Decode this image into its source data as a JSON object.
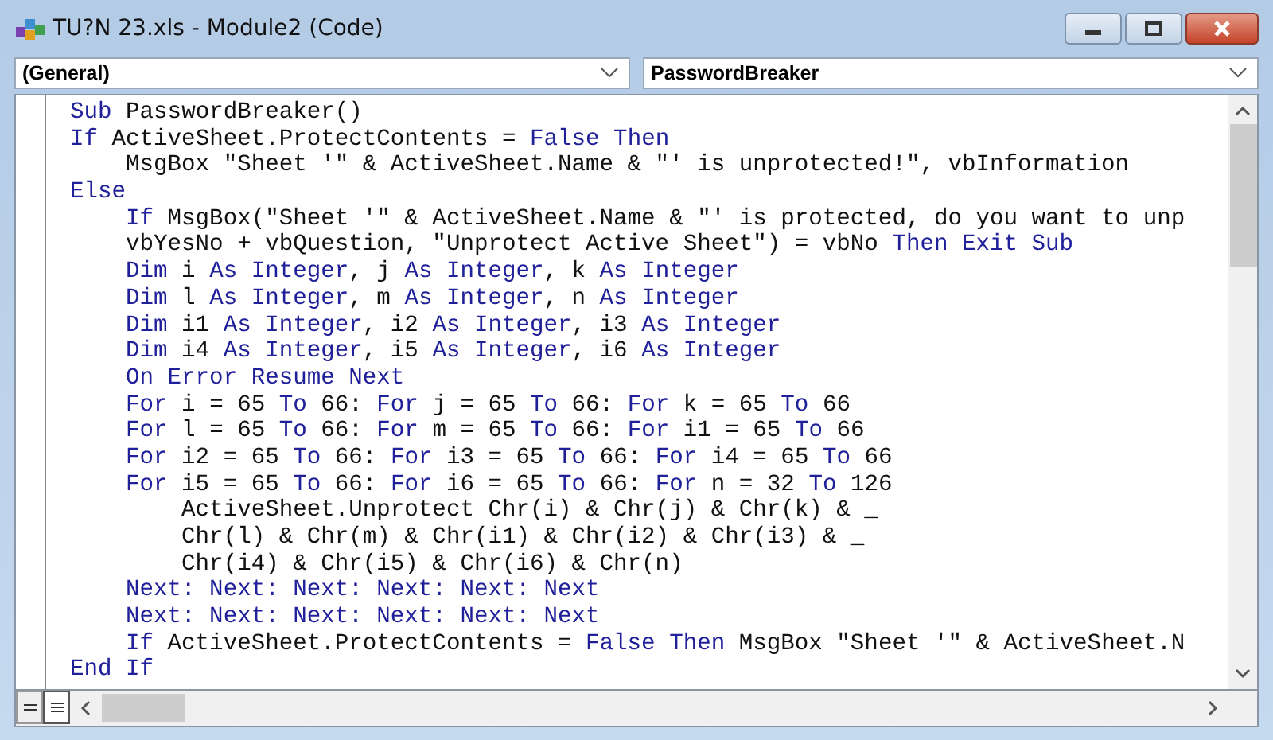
{
  "window": {
    "title": "TU?N 23.xls - Module2 (Code)"
  },
  "object_dropdown": {
    "value": "(General)"
  },
  "procedure_dropdown": {
    "value": "PasswordBreaker"
  },
  "code_lines": [
    {
      "tokens": [
        {
          "kind": "keyword",
          "text": "Sub"
        },
        {
          "kind": "text",
          "text": " PasswordBreaker()"
        }
      ]
    },
    {
      "tokens": [
        {
          "kind": "keyword",
          "text": "If"
        },
        {
          "kind": "text",
          "text": " ActiveSheet.ProtectContents = "
        },
        {
          "kind": "keyword",
          "text": "False Then"
        }
      ],
      "children": [
        {
          "tokens": [
            {
              "kind": "text",
              "text": "MsgBox \"Sheet '\" & ActiveSheet.Name & \"' is unprotected!\", vbInformation"
            }
          ]
        }
      ]
    },
    {
      "tokens": [
        {
          "kind": "keyword",
          "text": "Else"
        }
      ],
      "children": [
        {
          "tokens": [
            {
              "kind": "keyword",
              "text": "If"
            },
            {
              "kind": "text",
              "text": " MsgBox(\"Sheet '\" & ActiveSheet.Name & \"' is protected, do you want to unp"
            }
          ]
        },
        {
          "tokens": [
            {
              "kind": "text",
              "text": "vbYesNo + vbQuestion, \"Unprotect Active Sheet\") = vbNo "
            },
            {
              "kind": "keyword",
              "text": "Then Exit Sub"
            }
          ]
        },
        {
          "tokens": [
            {
              "kind": "keyword",
              "text": "Dim"
            },
            {
              "kind": "text",
              "text": " i "
            },
            {
              "kind": "keyword",
              "text": "As Integer"
            },
            {
              "kind": "text",
              "text": ", j "
            },
            {
              "kind": "keyword",
              "text": "As Integer"
            },
            {
              "kind": "text",
              "text": ", k "
            },
            {
              "kind": "keyword",
              "text": "As Integer"
            }
          ]
        },
        {
          "tokens": [
            {
              "kind": "keyword",
              "text": "Dim"
            },
            {
              "kind": "text",
              "text": " l "
            },
            {
              "kind": "keyword",
              "text": "As Integer"
            },
            {
              "kind": "text",
              "text": ", m "
            },
            {
              "kind": "keyword",
              "text": "As Integer"
            },
            {
              "kind": "text",
              "text": ", n "
            },
            {
              "kind": "keyword",
              "text": "As Integer"
            }
          ]
        },
        {
          "tokens": [
            {
              "kind": "keyword",
              "text": "Dim"
            },
            {
              "kind": "text",
              "text": " i1 "
            },
            {
              "kind": "keyword",
              "text": "As Integer"
            },
            {
              "kind": "text",
              "text": ", i2 "
            },
            {
              "kind": "keyword",
              "text": "As Integer"
            },
            {
              "kind": "text",
              "text": ", i3 "
            },
            {
              "kind": "keyword",
              "text": "As Integer"
            }
          ]
        },
        {
          "tokens": [
            {
              "kind": "keyword",
              "text": "Dim"
            },
            {
              "kind": "text",
              "text": " i4 "
            },
            {
              "kind": "keyword",
              "text": "As Integer"
            },
            {
              "kind": "text",
              "text": ", i5 "
            },
            {
              "kind": "keyword",
              "text": "As Integer"
            },
            {
              "kind": "text",
              "text": ", i6 "
            },
            {
              "kind": "keyword",
              "text": "As Integer"
            }
          ]
        },
        {
          "tokens": [
            {
              "kind": "keyword",
              "text": "On Error Resume Next"
            }
          ]
        },
        {
          "tokens": [
            {
              "kind": "keyword",
              "text": "For"
            },
            {
              "kind": "text",
              "text": " i = 65 "
            },
            {
              "kind": "keyword",
              "text": "To"
            },
            {
              "kind": "text",
              "text": " 66: "
            },
            {
              "kind": "keyword",
              "text": "For"
            },
            {
              "kind": "text",
              "text": " j = 65 "
            },
            {
              "kind": "keyword",
              "text": "To"
            },
            {
              "kind": "text",
              "text": " 66: "
            },
            {
              "kind": "keyword",
              "text": "For"
            },
            {
              "kind": "text",
              "text": " k = 65 "
            },
            {
              "kind": "keyword",
              "text": "To"
            },
            {
              "kind": "text",
              "text": " 66"
            }
          ]
        },
        {
          "tokens": [
            {
              "kind": "keyword",
              "text": "For"
            },
            {
              "kind": "text",
              "text": " l = 65 "
            },
            {
              "kind": "keyword",
              "text": "To"
            },
            {
              "kind": "text",
              "text": " 66: "
            },
            {
              "kind": "keyword",
              "text": "For"
            },
            {
              "kind": "text",
              "text": " m = 65 "
            },
            {
              "kind": "keyword",
              "text": "To"
            },
            {
              "kind": "text",
              "text": " 66: "
            },
            {
              "kind": "keyword",
              "text": "For"
            },
            {
              "kind": "text",
              "text": " i1 = 65 "
            },
            {
              "kind": "keyword",
              "text": "To"
            },
            {
              "kind": "text",
              "text": " 66"
            }
          ]
        },
        {
          "tokens": [
            {
              "kind": "keyword",
              "text": "For"
            },
            {
              "kind": "text",
              "text": " i2 = 65 "
            },
            {
              "kind": "keyword",
              "text": "To"
            },
            {
              "kind": "text",
              "text": " 66: "
            },
            {
              "kind": "keyword",
              "text": "For"
            },
            {
              "kind": "text",
              "text": " i3 = 65 "
            },
            {
              "kind": "keyword",
              "text": "To"
            },
            {
              "kind": "text",
              "text": " 66: "
            },
            {
              "kind": "keyword",
              "text": "For"
            },
            {
              "kind": "text",
              "text": " i4 = 65 "
            },
            {
              "kind": "keyword",
              "text": "To"
            },
            {
              "kind": "text",
              "text": " 66"
            }
          ]
        },
        {
          "tokens": [
            {
              "kind": "keyword",
              "text": "For"
            },
            {
              "kind": "text",
              "text": " i5 = 65 "
            },
            {
              "kind": "keyword",
              "text": "To"
            },
            {
              "kind": "text",
              "text": " 66: "
            },
            {
              "kind": "keyword",
              "text": "For"
            },
            {
              "kind": "text",
              "text": " i6 = 65 "
            },
            {
              "kind": "keyword",
              "text": "To"
            },
            {
              "kind": "text",
              "text": " 66: "
            },
            {
              "kind": "keyword",
              "text": "For"
            },
            {
              "kind": "text",
              "text": " n = 32 "
            },
            {
              "kind": "keyword",
              "text": "To"
            },
            {
              "kind": "text",
              "text": " 126"
            }
          ],
          "children": [
            {
              "tokens": [
                {
                  "kind": "text",
                  "text": "ActiveSheet.Unprotect Chr(i) & Chr(j) & Chr(k) & _"
                }
              ]
            },
            {
              "tokens": [
                {
                  "kind": "text",
                  "text": "Chr(l) & Chr(m) & Chr(i1) & Chr(i2) & Chr(i3) & _"
                }
              ]
            },
            {
              "tokens": [
                {
                  "kind": "text",
                  "text": "Chr(i4) & Chr(i5) & Chr(i6) & Chr(n)"
                }
              ]
            }
          ]
        },
        {
          "tokens": [
            {
              "kind": "keyword",
              "text": "Next: Next: Next: Next: Next: Next"
            }
          ]
        },
        {
          "tokens": [
            {
              "kind": "keyword",
              "text": "Next: Next: Next: Next: Next: Next"
            }
          ]
        },
        {
          "tokens": [
            {
              "kind": "keyword",
              "text": "If"
            },
            {
              "kind": "text",
              "text": " ActiveSheet.ProtectContents = "
            },
            {
              "kind": "keyword",
              "text": "False Then"
            },
            {
              "kind": "text",
              "text": " MsgBox \"Sheet '\" & ActiveSheet.N"
            }
          ]
        }
      ]
    },
    {
      "tokens": [
        {
          "kind": "keyword",
          "text": "End If"
        }
      ]
    }
  ],
  "view_buttons": [
    {
      "kind": "procedure",
      "selected": false
    },
    {
      "kind": "module",
      "selected": true
    }
  ]
}
